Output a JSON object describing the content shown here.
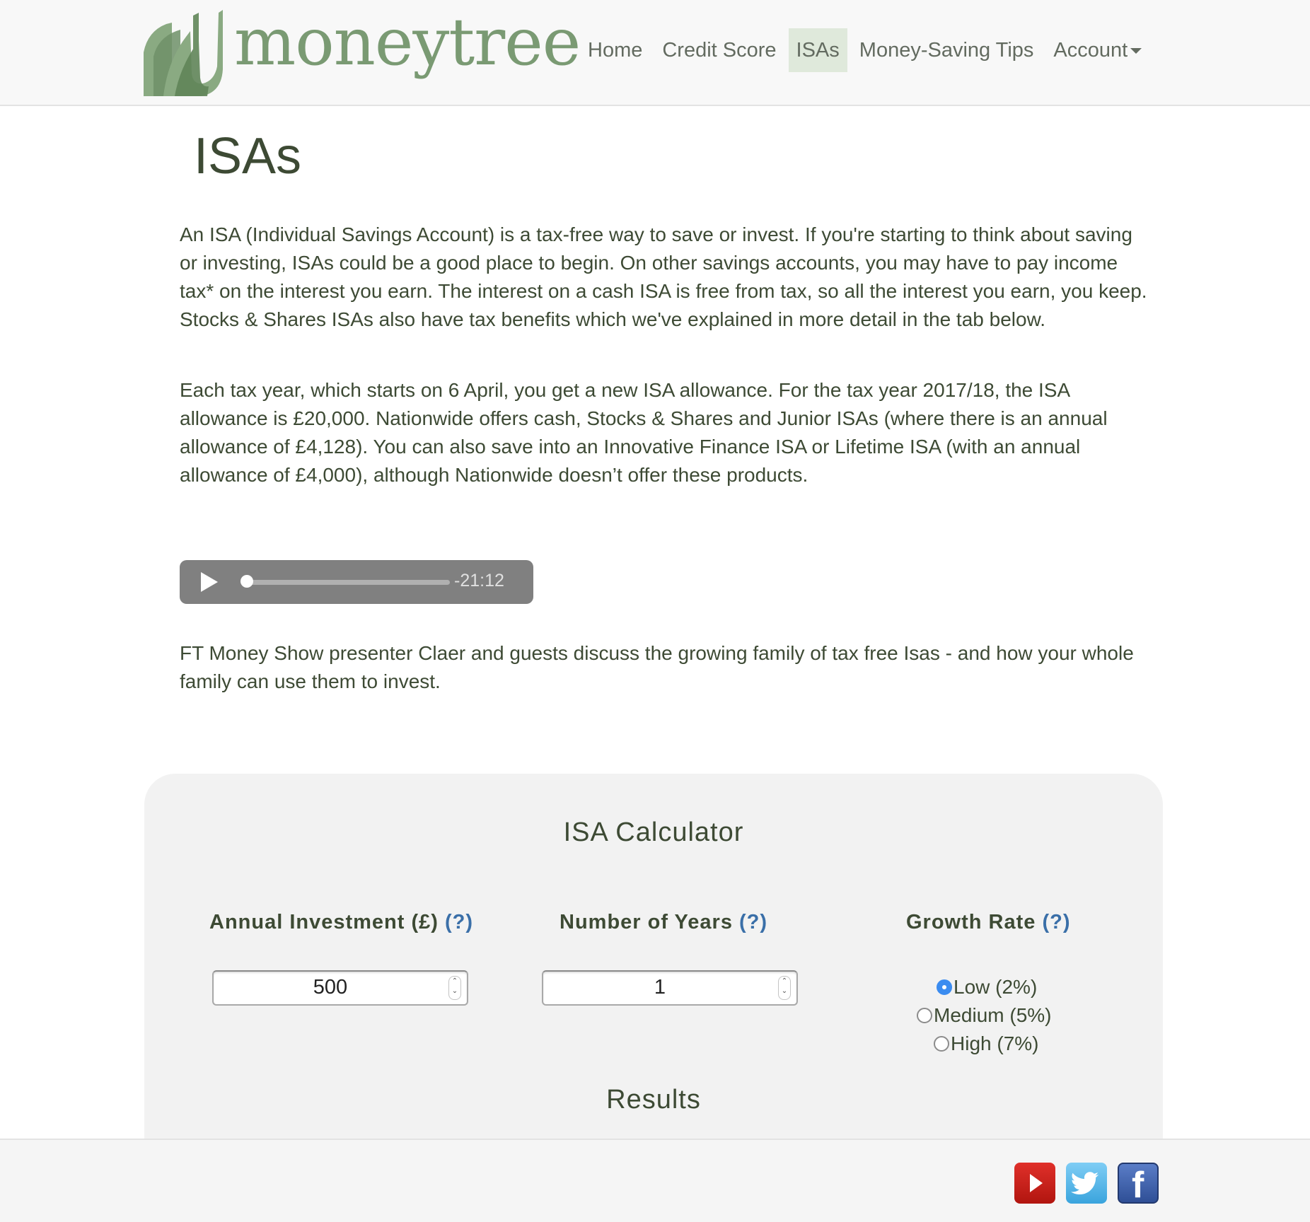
{
  "brand": {
    "name": "moneytree"
  },
  "nav": {
    "items": [
      {
        "label": "Home",
        "active": false
      },
      {
        "label": "Credit Score",
        "active": false
      },
      {
        "label": "ISAs",
        "active": true
      },
      {
        "label": "Money-Saving Tips",
        "active": false
      },
      {
        "label": "Account",
        "active": false,
        "dropdown": true
      }
    ]
  },
  "page": {
    "title": "ISAs",
    "paragraphs": [
      "An ISA (Individual Savings Account) is a tax-free way to save or invest. If you're starting to think about saving or investing, ISAs could be a good place to begin. On other savings accounts, you may have to pay income tax* on the interest you earn. The interest on a cash ISA is free from tax, so all the interest you earn, you keep. Stocks & Shares ISAs also have tax benefits which we've explained in more detail in the tab below.",
      "Each tax year, which starts on 6 April, you get a new ISA allowance. For the tax year 2017/18, the ISA allowance is £20,000. Nationwide offers cash, Stocks & Shares and Junior ISAs (where there is an annual allowance of £4,128). You can also save into an Innovative Finance ISA or Lifetime ISA (with an annual allowance of £4,000), although Nationwide doesn’t offer these products."
    ],
    "audio": {
      "remaining": "-21:12",
      "progress": 0
    },
    "audio_caption": "FT Money Show presenter Claer and guests discuss the growing family of tax free Isas - and how your whole family can use them to invest."
  },
  "calculator": {
    "title": "ISA Calculator",
    "help": "(?)",
    "annual_investment": {
      "label": "Annual Investment (£)",
      "value": "500"
    },
    "years": {
      "label": "Number of Years",
      "value": "1"
    },
    "growth": {
      "label": "Growth Rate",
      "options": [
        {
          "label": "Low (2%)",
          "checked": true
        },
        {
          "label": "Medium (5%)",
          "checked": false
        },
        {
          "label": "High (7%)",
          "checked": false
        }
      ]
    },
    "results_title": "Results"
  },
  "footer": {
    "social": [
      "youtube-icon",
      "twitter-icon",
      "facebook-icon"
    ]
  },
  "colors": {
    "brand_green": "#7a9a73",
    "nav_active": "#dfe9db",
    "text": "#3d4a34",
    "help_link": "#3a6fa8",
    "radio_checked": "#3b8cf0"
  }
}
